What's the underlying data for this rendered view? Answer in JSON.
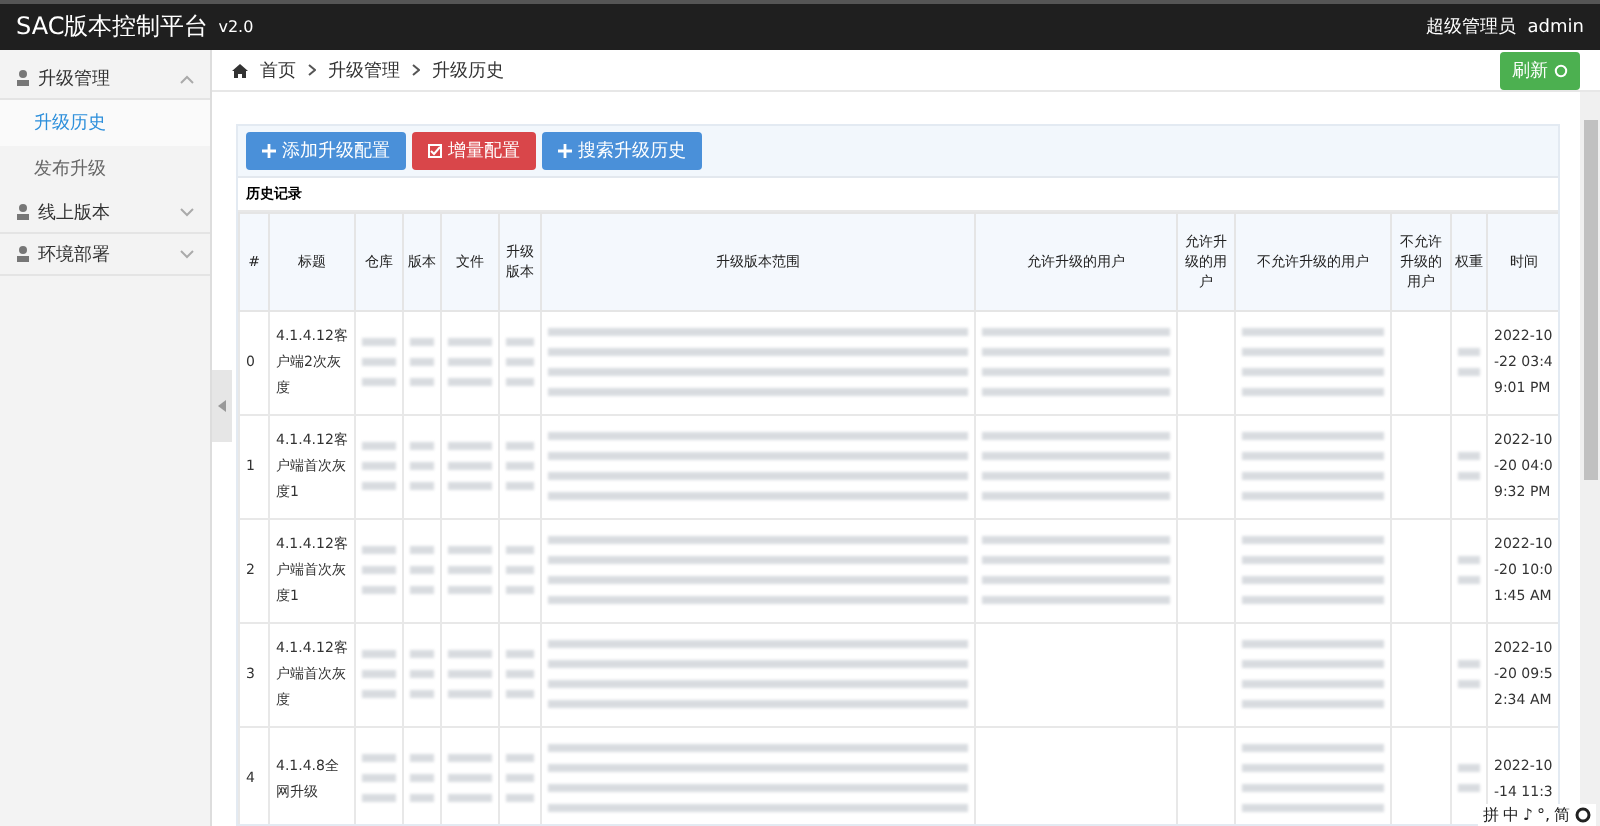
{
  "header": {
    "brand": "SAC版本控制平台",
    "version": "v2.0",
    "role": "超级管理员",
    "user": "admin"
  },
  "sidebar": {
    "items": [
      {
        "label": "升级管理",
        "expanded": true,
        "children": [
          {
            "label": "升级历史",
            "selected": true
          },
          {
            "label": "发布升级",
            "selected": false
          }
        ]
      },
      {
        "label": "线上版本",
        "expanded": false
      },
      {
        "label": "环境部署",
        "expanded": false
      }
    ]
  },
  "breadcrumb": [
    "首页",
    "升级管理",
    "升级历史"
  ],
  "refresh_button": "刷新",
  "toolbar": [
    {
      "label": "添加升级配置",
      "kind": "primary"
    },
    {
      "label": "增量配置",
      "kind": "danger"
    },
    {
      "label": "搜索升级历史",
      "kind": "primary"
    }
  ],
  "table": {
    "title": "历史记录",
    "columns": [
      "#",
      "标题",
      "仓库",
      "版本",
      "文件",
      "升级版本",
      "升级版本范围",
      "允许升级的用户",
      "允许升级的用户",
      "不允许升级的用户",
      "不允许升级的用户",
      "权重",
      "时间"
    ],
    "rows": [
      {
        "cells": [
          {
            "kind": "text",
            "text": "0"
          },
          {
            "kind": "text",
            "text": "4.1.4.12客户端2次灰度"
          },
          {
            "kind": "blurred"
          },
          {
            "kind": "blurred"
          },
          {
            "kind": "blurred"
          },
          {
            "kind": "blurred"
          },
          {
            "kind": "blurred"
          },
          {
            "kind": "blurred"
          },
          {
            "kind": "empty"
          },
          {
            "kind": "blurred"
          },
          {
            "kind": "empty"
          },
          {
            "kind": "blurred"
          },
          {
            "kind": "text",
            "text": "2022-10-22 03:49:01 PM"
          }
        ]
      },
      {
        "cells": [
          {
            "kind": "text",
            "text": "1"
          },
          {
            "kind": "text",
            "text": "4.1.4.12客户端首次灰度1"
          },
          {
            "kind": "blurred"
          },
          {
            "kind": "blurred"
          },
          {
            "kind": "blurred"
          },
          {
            "kind": "blurred"
          },
          {
            "kind": "blurred"
          },
          {
            "kind": "blurred"
          },
          {
            "kind": "empty"
          },
          {
            "kind": "blurred"
          },
          {
            "kind": "empty"
          },
          {
            "kind": "blurred"
          },
          {
            "kind": "text",
            "text": "2022-10-20 04:09:32 PM"
          }
        ]
      },
      {
        "cells": [
          {
            "kind": "text",
            "text": "2"
          },
          {
            "kind": "text",
            "text": "4.1.4.12客户端首次灰度1"
          },
          {
            "kind": "blurred"
          },
          {
            "kind": "blurred"
          },
          {
            "kind": "blurred"
          },
          {
            "kind": "blurred"
          },
          {
            "kind": "blurred"
          },
          {
            "kind": "blurred"
          },
          {
            "kind": "empty"
          },
          {
            "kind": "blurred"
          },
          {
            "kind": "empty"
          },
          {
            "kind": "blurred"
          },
          {
            "kind": "text",
            "text": "2022-10-20 10:01:45 AM"
          }
        ]
      },
      {
        "cells": [
          {
            "kind": "text",
            "text": "3"
          },
          {
            "kind": "text",
            "text": "4.1.4.12客户端首次灰度"
          },
          {
            "kind": "blurred"
          },
          {
            "kind": "blurred"
          },
          {
            "kind": "blurred"
          },
          {
            "kind": "blurred"
          },
          {
            "kind": "blurred"
          },
          {
            "kind": "empty"
          },
          {
            "kind": "empty"
          },
          {
            "kind": "blurred"
          },
          {
            "kind": "empty"
          },
          {
            "kind": "blurred"
          },
          {
            "kind": "text",
            "text": "2022-10-20 09:52:34 AM"
          }
        ]
      },
      {
        "cells": [
          {
            "kind": "text",
            "text": "4"
          },
          {
            "kind": "text",
            "text": "4.1.4.8全网升级"
          },
          {
            "kind": "blurred"
          },
          {
            "kind": "blurred"
          },
          {
            "kind": "blurred"
          },
          {
            "kind": "blurred"
          },
          {
            "kind": "blurred"
          },
          {
            "kind": "empty"
          },
          {
            "kind": "empty"
          },
          {
            "kind": "blurred"
          },
          {
            "kind": "empty"
          },
          {
            "kind": "blurred"
          },
          {
            "kind": "text",
            "text": "2022-10-14 11:3"
          }
        ]
      }
    ]
  },
  "ime_bar": [
    "拼",
    "中",
    "♪",
    "°,",
    "简"
  ]
}
